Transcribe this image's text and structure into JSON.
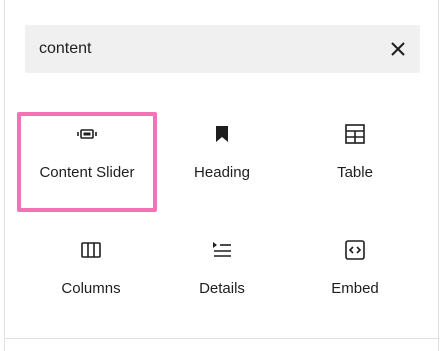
{
  "search": {
    "value": "content",
    "placeholder": "Search",
    "clear_icon": "close-icon"
  },
  "blocks": [
    {
      "label": "Content Slider",
      "icon": "content-slider-icon",
      "highlighted": true
    },
    {
      "label": "Heading",
      "icon": "bookmark-icon",
      "highlighted": false
    },
    {
      "label": "Table",
      "icon": "table-icon",
      "highlighted": false
    },
    {
      "label": "Columns",
      "icon": "columns-icon",
      "highlighted": false
    },
    {
      "label": "Details",
      "icon": "details-icon",
      "highlighted": false
    },
    {
      "label": "Embed",
      "icon": "embed-icon",
      "highlighted": false
    }
  ],
  "colors": {
    "highlight": "#f472b6",
    "search_bg": "#f0f0f0",
    "text": "#1e1e1e"
  }
}
